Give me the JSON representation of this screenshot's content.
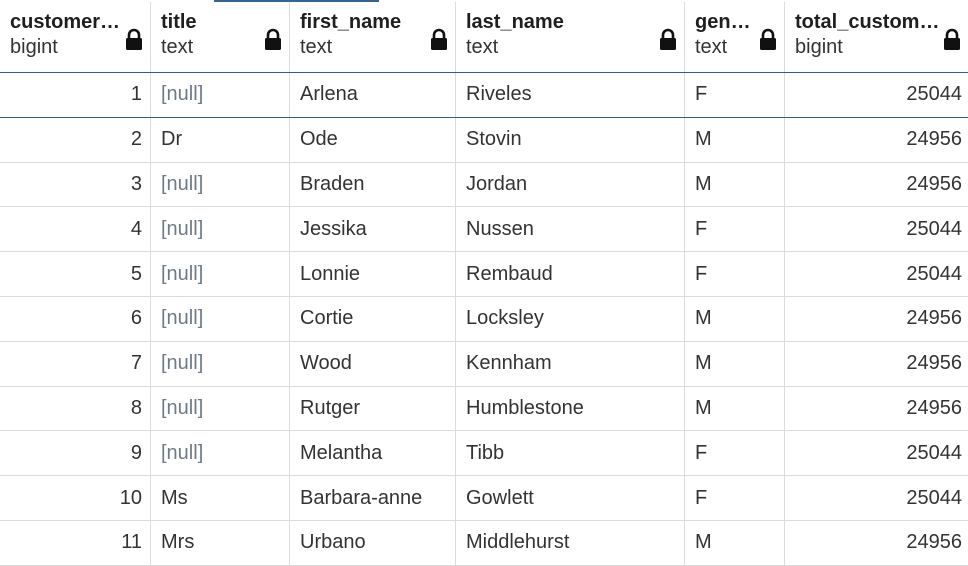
{
  "columns": [
    {
      "name": "customer_id",
      "type": "bigint",
      "icon": "lock-icon"
    },
    {
      "name": "title",
      "type": "text",
      "icon": "lock-icon"
    },
    {
      "name": "first_name",
      "type": "text",
      "icon": "lock-icon"
    },
    {
      "name": "last_name",
      "type": "text",
      "icon": "lock-icon"
    },
    {
      "name": "gender",
      "type": "text",
      "icon": "lock-icon"
    },
    {
      "name": "total_customers",
      "type": "bigint",
      "icon": "lock-icon"
    }
  ],
  "rows": [
    [
      "1",
      "[null]",
      "Arlena",
      "Riveles",
      "F",
      "25044"
    ],
    [
      "2",
      "Dr",
      "Ode",
      "Stovin",
      "M",
      "24956"
    ],
    [
      "3",
      "[null]",
      "Braden",
      "Jordan",
      "M",
      "24956"
    ],
    [
      "4",
      "[null]",
      "Jessika",
      "Nussen",
      "F",
      "25044"
    ],
    [
      "5",
      "[null]",
      "Lonnie",
      "Rembaud",
      "F",
      "25044"
    ],
    [
      "6",
      "[null]",
      "Cortie",
      "Locksley",
      "M",
      "24956"
    ],
    [
      "7",
      "[null]",
      "Wood",
      "Kennham",
      "M",
      "24956"
    ],
    [
      "8",
      "[null]",
      "Rutger",
      "Humblestone",
      "M",
      "24956"
    ],
    [
      "9",
      "[null]",
      "Melantha",
      "Tibb",
      "F",
      "25044"
    ],
    [
      "10",
      "Ms",
      "Barbara-anne",
      "Gowlett",
      "F",
      "25044"
    ],
    [
      "11",
      "Mrs",
      "Urbano",
      "Middlehurst",
      "M",
      "24956"
    ]
  ],
  "null_marker": "[null]",
  "colors": {
    "accent": "#326690",
    "null_text": "#6f7a88",
    "grid_line": "#dcdcdc"
  }
}
